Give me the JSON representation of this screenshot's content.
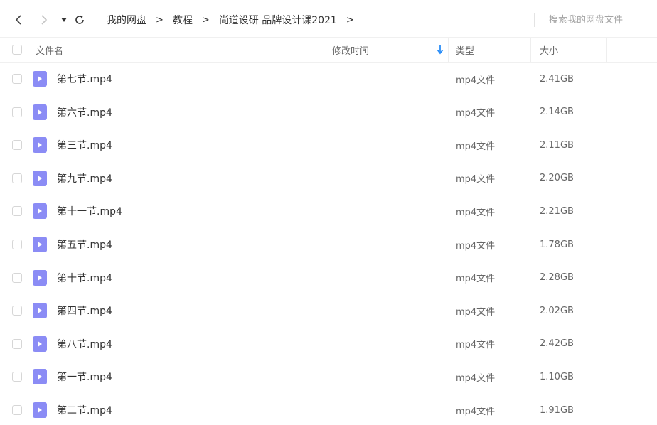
{
  "toolbar": {
    "breadcrumbs": [
      "我的网盘",
      "教程",
      "尚道设研 品牌设计课2021"
    ],
    "breadcrumb_separator": ">",
    "search_placeholder": "搜索我的网盘文件"
  },
  "columns": {
    "name": "文件名",
    "modified": "修改时间",
    "type": "类型",
    "size": "大小"
  },
  "colors": {
    "file_icon": "#8b8cf5",
    "sort_arrow": "#2b8ef8"
  },
  "files": [
    {
      "name": "第七节.mp4",
      "type": "mp4文件",
      "size": "2.41GB"
    },
    {
      "name": "第六节.mp4",
      "type": "mp4文件",
      "size": "2.14GB"
    },
    {
      "name": "第三节.mp4",
      "type": "mp4文件",
      "size": "2.11GB"
    },
    {
      "name": "第九节.mp4",
      "type": "mp4文件",
      "size": "2.20GB"
    },
    {
      "name": "第十一节.mp4",
      "type": "mp4文件",
      "size": "2.21GB"
    },
    {
      "name": "第五节.mp4",
      "type": "mp4文件",
      "size": "1.78GB"
    },
    {
      "name": "第十节.mp4",
      "type": "mp4文件",
      "size": "2.28GB"
    },
    {
      "name": "第四节.mp4",
      "type": "mp4文件",
      "size": "2.02GB"
    },
    {
      "name": "第八节.mp4",
      "type": "mp4文件",
      "size": "2.42GB"
    },
    {
      "name": "第一节.mp4",
      "type": "mp4文件",
      "size": "1.10GB"
    },
    {
      "name": "第二节.mp4",
      "type": "mp4文件",
      "size": "1.91GB"
    }
  ]
}
